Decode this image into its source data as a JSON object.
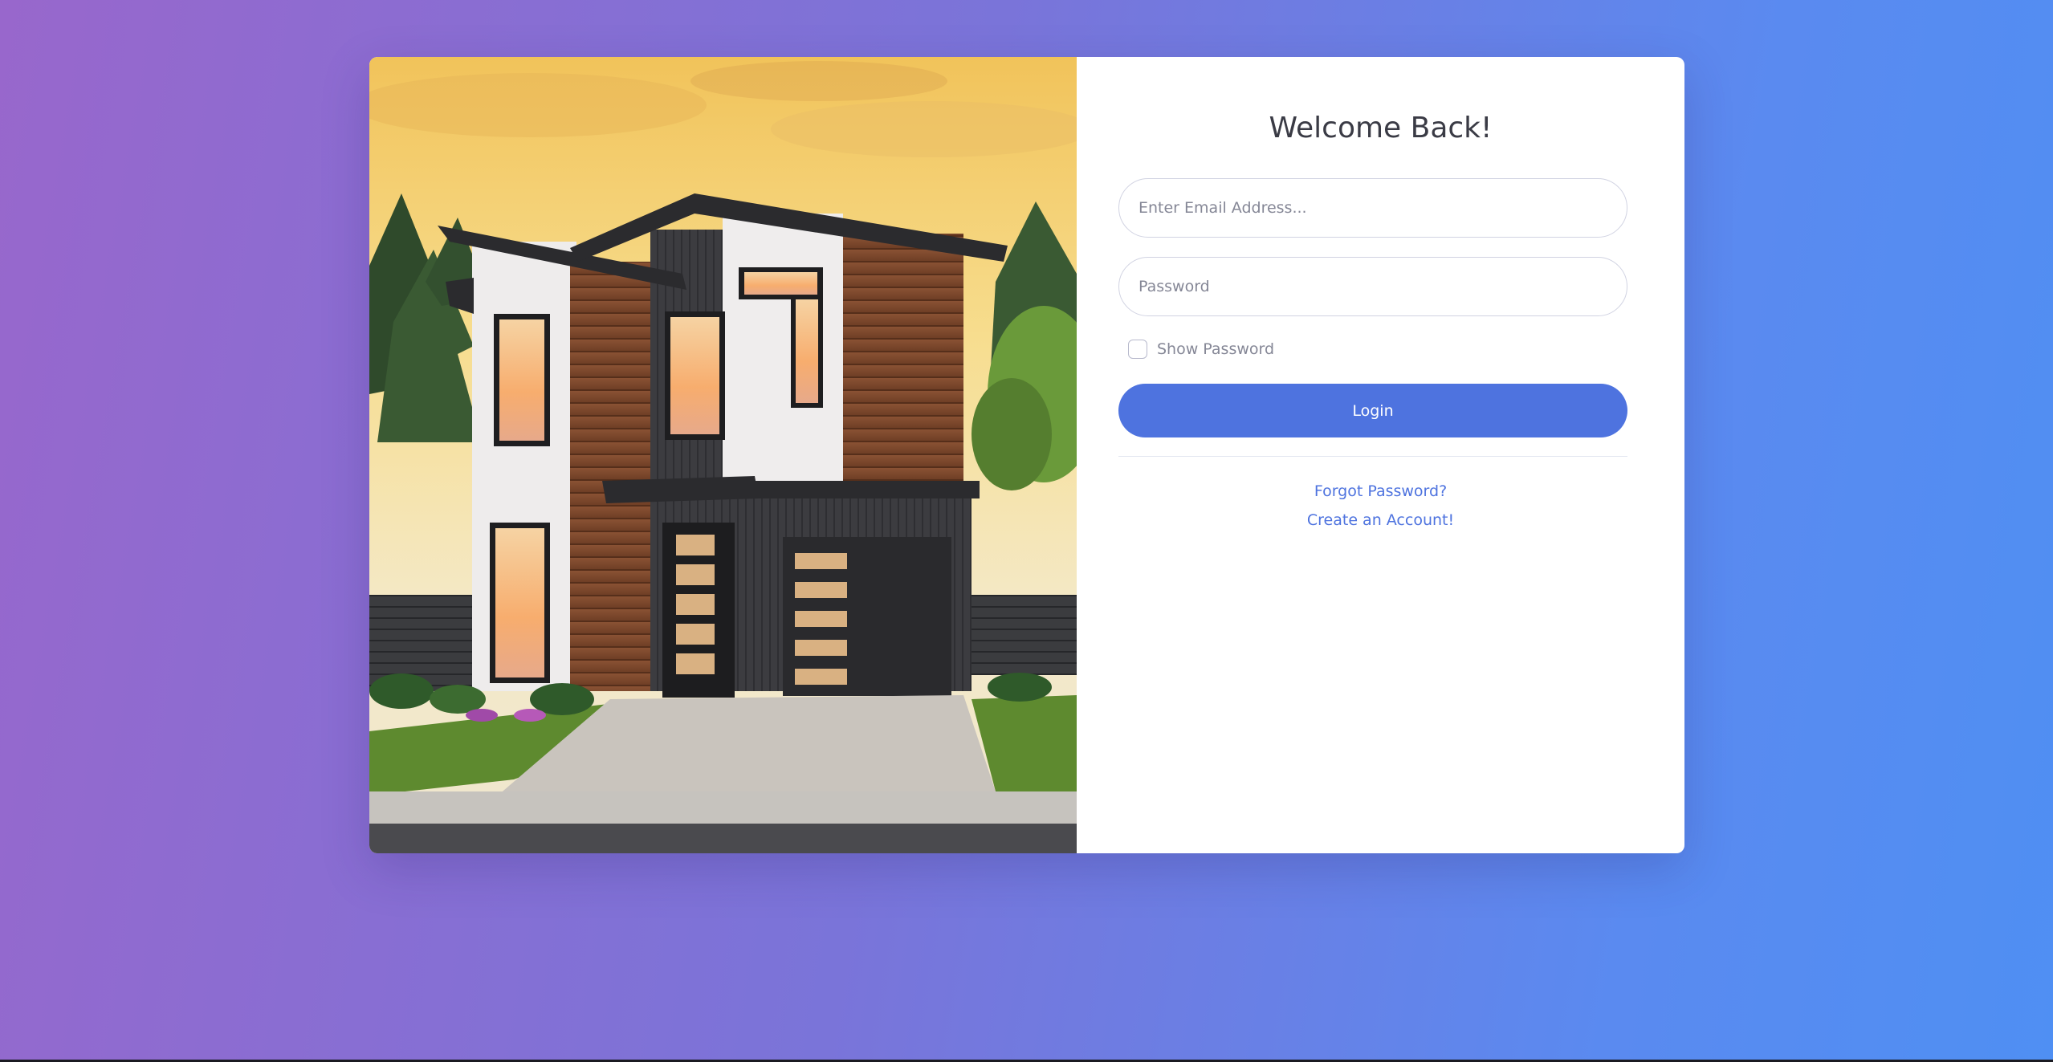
{
  "login": {
    "title": "Welcome Back!",
    "email_placeholder": "Enter Email Address...",
    "password_placeholder": "Password",
    "show_password_label": "Show Password",
    "login_label": "Login",
    "forgot_password_label": "Forgot Password?",
    "create_account_label": "Create an Account!"
  },
  "colors": {
    "accent": "#4e73df",
    "background_start": "#9867cc",
    "background_end": "#4f8ff3"
  }
}
